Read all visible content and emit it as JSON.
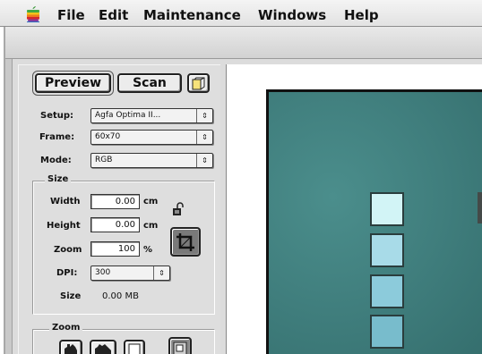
{
  "menubar": {
    "items": [
      "File",
      "Edit",
      "Maintenance",
      "Windows",
      "Help"
    ]
  },
  "toolbar": {
    "preview_label": "Preview",
    "scan_label": "Scan"
  },
  "settings": {
    "setup_label": "Setup:",
    "setup_value": "Agfa Optima II...",
    "frame_label": "Frame:",
    "frame_value": "60x70",
    "mode_label": "Mode:",
    "mode_value": "RGB"
  },
  "size_group": {
    "title": "Size",
    "width_label": "Width",
    "width_value": "0.00",
    "width_unit": "cm",
    "height_label": "Height",
    "height_value": "0.00",
    "height_unit": "cm",
    "zoom_label": "Zoom",
    "zoom_value": "100",
    "zoom_unit": "%",
    "dpi_label": "DPI:",
    "dpi_value": "300",
    "size_label": "Size",
    "size_value": "0.00 MB"
  },
  "zoom_group": {
    "title": "Zoom"
  },
  "colors": {
    "preview_bg": "#3f7d7c",
    "swatches": [
      "#d2f4f6",
      "#a8dbe8",
      "#8ccbdb",
      "#78bccc"
    ]
  },
  "icons": {
    "apple": "apple-menu-icon",
    "frame": "frame-icon",
    "lock": "lock-icon",
    "crop": "crop-icon",
    "zoom_tools": [
      "zoom-hand-icon",
      "zoom-hand-icon",
      "zoom-fit-icon",
      "zoom-select-icon"
    ],
    "popup_arrows": [
      "popup-arrow-icon",
      "popup-stepper-icon",
      "popup-arrow-icon",
      "popup-arrow-icon"
    ]
  }
}
